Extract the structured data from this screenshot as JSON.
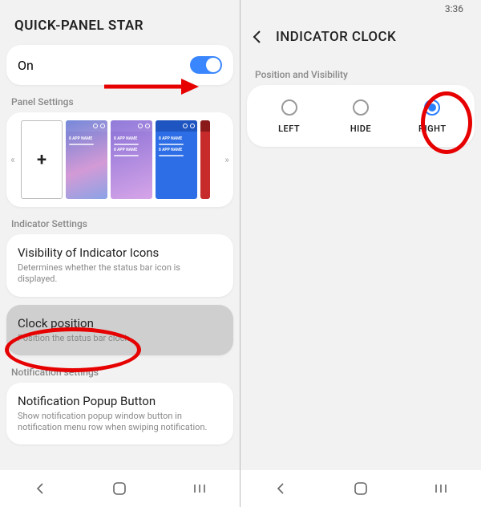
{
  "left": {
    "header": "QUICK-PANEL STAR",
    "toggle_label": "On",
    "section_panel": "Panel Settings",
    "add_glyph": "+",
    "section_indicator": "Indicator Settings",
    "visibility": {
      "title": "Visibility of Indicator Icons",
      "sub": "Determines whether the status bar icon is displayed."
    },
    "clock": {
      "title": "Clock position",
      "sub": "Position the status bar clock."
    },
    "section_notif": "Notification settings",
    "notif": {
      "title": "Notification Popup Button",
      "sub": "Show notification popup window button in notification menu row when swiping notification."
    }
  },
  "right": {
    "time": "3:36",
    "header": "INDICATOR CLOCK",
    "section": "Position and Visibility",
    "options": {
      "left": "LEFT",
      "hide": "HIDE",
      "right": "RIGHT"
    }
  }
}
